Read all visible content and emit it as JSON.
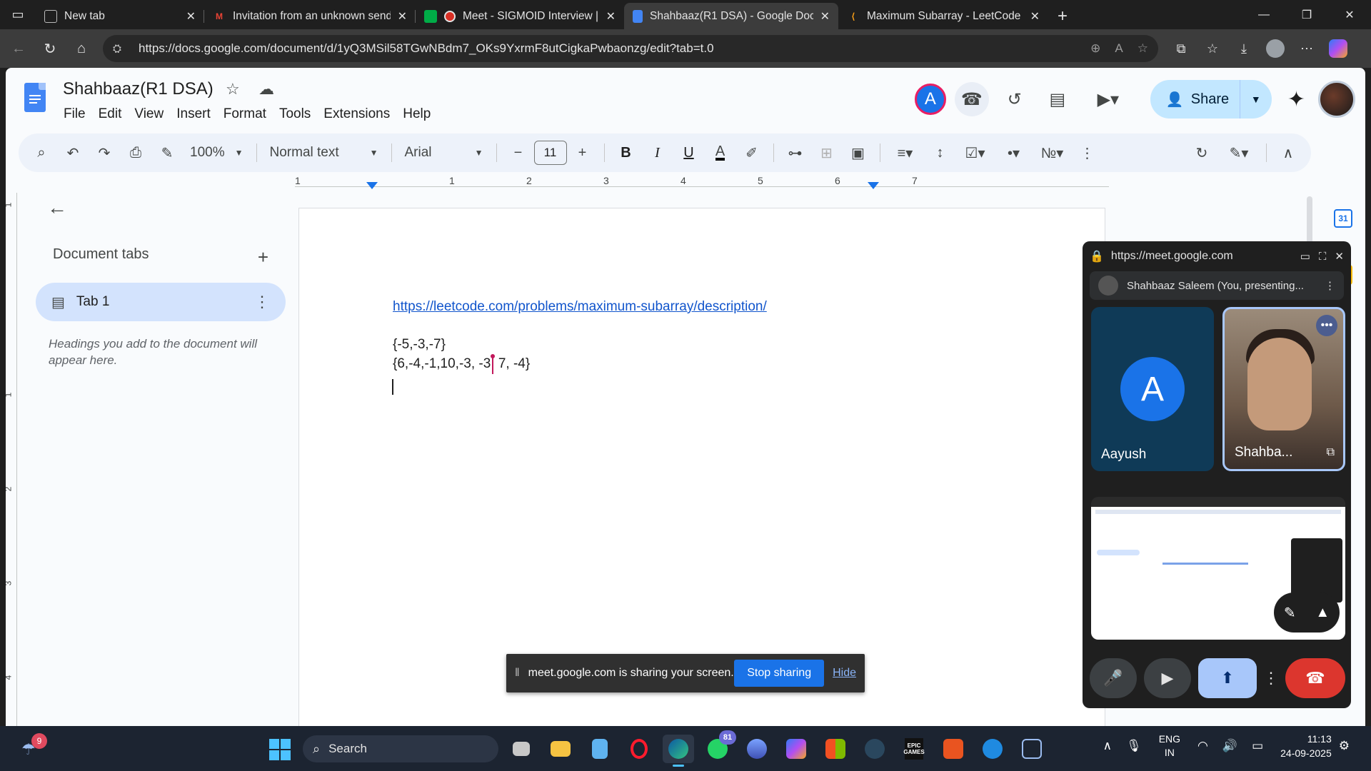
{
  "browser": {
    "tabs": [
      {
        "title": "New tab",
        "icon": "new-tab-icon",
        "color": "#5f6368"
      },
      {
        "title": "Invitation from an unknown send",
        "icon": "gmail-icon",
        "color": "#ea4335"
      },
      {
        "title": "Meet - SIGMOID Interview | I",
        "icon": "meet-icon",
        "color": "#00ac47"
      },
      {
        "title": "Shahbaaz(R1 DSA) - Google Docs",
        "icon": "docs-icon",
        "color": "#4285f4",
        "active": true
      },
      {
        "title": "Maximum Subarray - LeetCode",
        "icon": "leetcode-icon",
        "color": "#ffa116"
      }
    ],
    "url": "https://docs.google.com/document/d/1yQ3MSil58TGwNBdm7_OKs9YxrmF8utCigkaPwbaonzg/edit?tab=t.0"
  },
  "docs": {
    "title": "Shahbaaz(R1 DSA)",
    "menu": [
      "File",
      "Edit",
      "View",
      "Insert",
      "Format",
      "Tools",
      "Extensions",
      "Help"
    ],
    "avatar_letter": "A",
    "share_label": "Share",
    "toolbar": {
      "zoom": "100%",
      "style": "Normal text",
      "font": "Arial",
      "font_size": "11"
    },
    "ruler_numbers": [
      "1",
      "1",
      "2",
      "3",
      "4",
      "5",
      "6",
      "7"
    ],
    "vruler_numbers": [
      "1",
      "1",
      "2",
      "3",
      "4"
    ],
    "outline": {
      "heading": "Document tabs",
      "tab_label": "Tab 1",
      "hint": "Headings you add to the document will appear here."
    },
    "content": {
      "link": "https://leetcode.com/problems/maximum-subarray/description/",
      "line1": "{-5,-3,-7}",
      "line2": "{6,-4,-1,10,-3, -3, 7, -4}"
    },
    "side_calendar": "31"
  },
  "sharing_bar": {
    "message": "meet.google.com is sharing your screen.",
    "stop_label": "Stop sharing",
    "hide_label": "Hide"
  },
  "meet": {
    "url": "https://meet.google.com",
    "presenter": "Shahbaaz Saleem (You, presenting...",
    "participants": [
      {
        "name": "Aayush",
        "initial": "A"
      },
      {
        "name": "Shahba..."
      }
    ]
  },
  "taskbar": {
    "notification_count": "9",
    "search_label": "Search",
    "whatsapp_badge": "81",
    "epic_label": "EPIC GAMES",
    "lang_line1": "ENG",
    "lang_line2": "IN",
    "time": "11:13",
    "date": "24-09-2025"
  }
}
